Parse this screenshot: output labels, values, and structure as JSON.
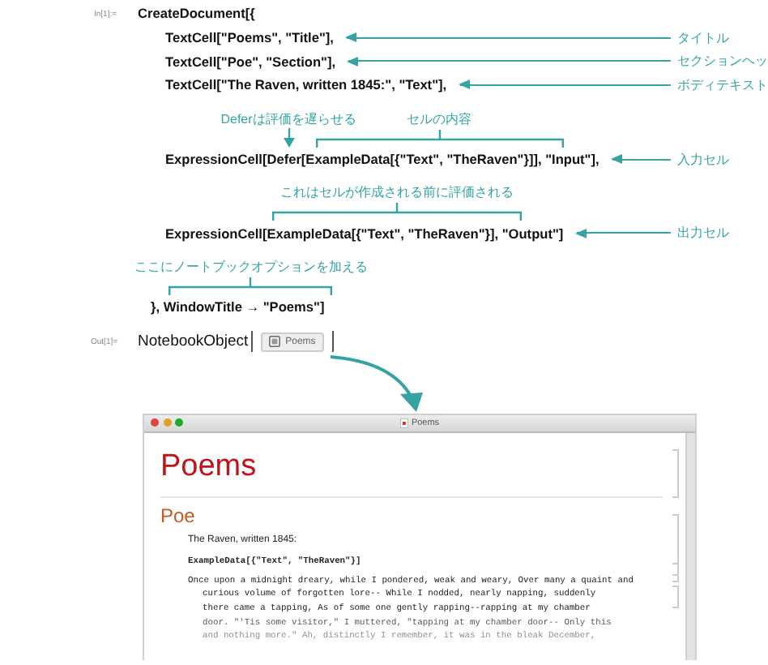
{
  "notebook": {
    "input_label": "In[1]:=",
    "lines": [
      {
        "kind": "head",
        "text": "CreateDocument[{"
      },
      {
        "kind": "item",
        "text": "TextCell[\"Poems\", \"Title\"],",
        "note": "タイトル"
      },
      {
        "kind": "item",
        "text": "TextCell[\"Poe\", \"Section\"],",
        "note": "セクションヘッ"
      },
      {
        "kind": "item",
        "text": "TextCell[\"The Raven, written 1845:\", \"Text\"],",
        "note": "ボディテキスト"
      },
      {
        "kind": "item",
        "text": "ExpressionCell[Defer[ExampleData[{\"Text\", \"TheRaven\"}]], \"Input\"],",
        "note": "入力セル",
        "callouts": [
          {
            "kind": "arrow",
            "text": "Deferは評価を遅らせる"
          },
          {
            "kind": "bracket",
            "text": "セルの内容"
          }
        ]
      },
      {
        "kind": "item",
        "text": "ExpressionCell[ExampleData[{\"Text\", \"TheRaven\"}], \"Output\"]",
        "note": "出力セル",
        "callouts": [
          {
            "kind": "bracket",
            "text": "これはセルが作成される前に評価される"
          }
        ]
      },
      {
        "kind": "tail",
        "text": "}, WindowTitle → \"Poems\"]",
        "callouts": [
          {
            "kind": "bracket",
            "text": "ここにノートブックオプションを加える"
          }
        ]
      }
    ],
    "output_label": "Out[1]=",
    "output_head": "NotebookObject",
    "output_chip": "Poems"
  },
  "window": {
    "title": "Poems",
    "cells": [
      {
        "kind": "title",
        "text": "Poems"
      },
      {
        "kind": "section",
        "text": "Poe"
      },
      {
        "kind": "text",
        "text": "The Raven, written 1845:"
      },
      {
        "kind": "input",
        "text": "ExampleData[{\"Text\", \"TheRaven\"}]"
      },
      {
        "kind": "output",
        "lines": [
          "Once upon a midnight dreary, while I pondered, weak and weary, Over many a quaint and",
          "curious volume of forgotten lore-- While I nodded, nearly napping, suddenly",
          "there came a tapping, As of some one gently rapping--rapping at my chamber",
          "door. \"'Tis some visitor,\" I muttered, \"tapping at my chamber door-- Only this",
          "and nothing more.\" Ah, distinctly I remember, it was in the bleak December,"
        ]
      }
    ]
  }
}
